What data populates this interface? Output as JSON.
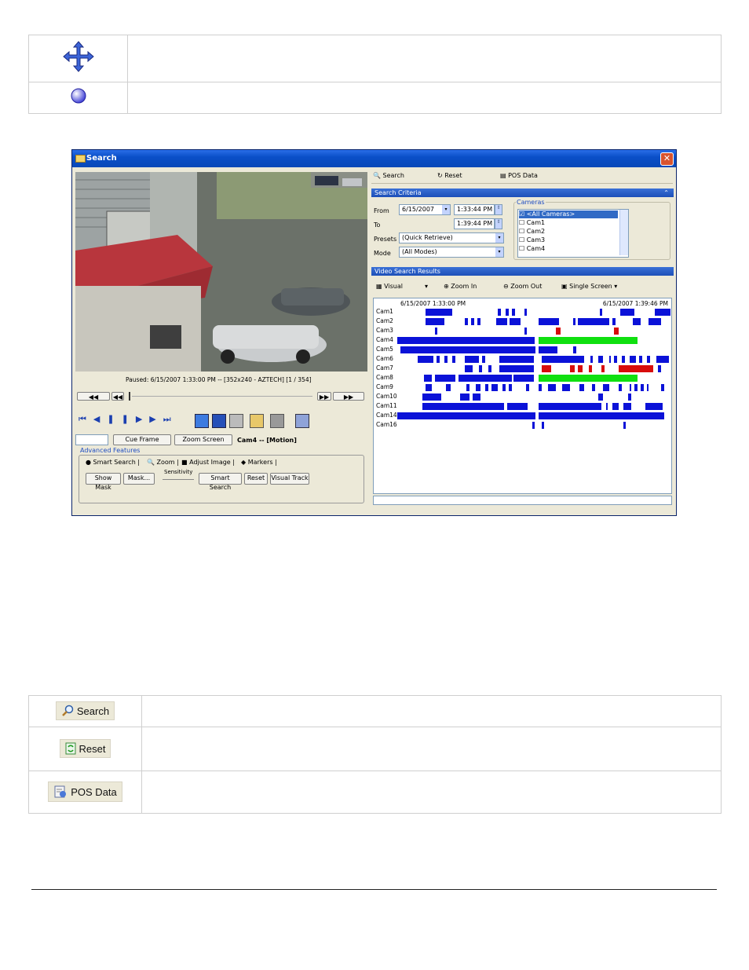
{
  "top_table": {
    "rows": [
      {
        "icon": "move-arrows-icon",
        "text": ""
      },
      {
        "icon": "circle-icon",
        "text": ""
      }
    ]
  },
  "window": {
    "title": "Search",
    "video_status": "Paused: 6/15/2007 1:33:00 PM  --  [352x240 - AZTECH] [1 / 354]",
    "cue_frame": "Cue Frame",
    "zoom_screen": "Zoom Screen",
    "cam_label": "Cam4 -- [Motion]",
    "advanced_features": "Advanced Features",
    "tabs": [
      "Smart Search",
      "Zoom",
      "Adjust Image",
      "Markers"
    ],
    "buttons": [
      "Show Mask",
      "Mask...",
      "Smart Search",
      "Reset",
      "Visual Track"
    ],
    "sensitivity": "Sensitivity",
    "toolbar": {
      "search": "Search",
      "reset": "Reset",
      "pos": "POS Data"
    },
    "criteria_head": "Search Criteria",
    "from_label": "From",
    "to_label": "To",
    "presets_label": "Presets",
    "mode_label": "Mode",
    "from_date": "6/15/2007",
    "from_time": "1:33:44 PM",
    "to_time": "1:39:44 PM",
    "presets_value": "(Quick Retrieve)",
    "mode_value": "(All Modes)",
    "cameras_label": "Cameras",
    "camera_list": [
      "<All Cameras>",
      "Cam1",
      "Cam2",
      "Cam3",
      "Cam4"
    ],
    "results_head": "Video Search Results",
    "results_toolbar": {
      "visual": "Visual",
      "zoom_in": "Zoom In",
      "zoom_out": "Zoom Out",
      "single": "Single Screen"
    },
    "timeline_start": "6/15/2007 1:33:00 PM",
    "timeline_end": "6/15/2007 1:39:46 PM",
    "cams": [
      "Cam1",
      "Cam2",
      "Cam3",
      "Cam4",
      "Cam5",
      "Cam6",
      "Cam7",
      "Cam8",
      "Cam9",
      "Cam10",
      "Cam11",
      "Cam14",
      "Cam16"
    ]
  },
  "bottom_table": {
    "rows": [
      {
        "chip": "Search",
        "icon": "magnifier-icon"
      },
      {
        "chip": "Reset",
        "icon": "reset-icon"
      },
      {
        "chip": "POS Data",
        "icon": "pos-data-icon"
      }
    ]
  },
  "colors": {
    "blue": "#0b12d8",
    "green": "#10e010",
    "red": "#d80c0c",
    "title": "#0a4fc8"
  }
}
